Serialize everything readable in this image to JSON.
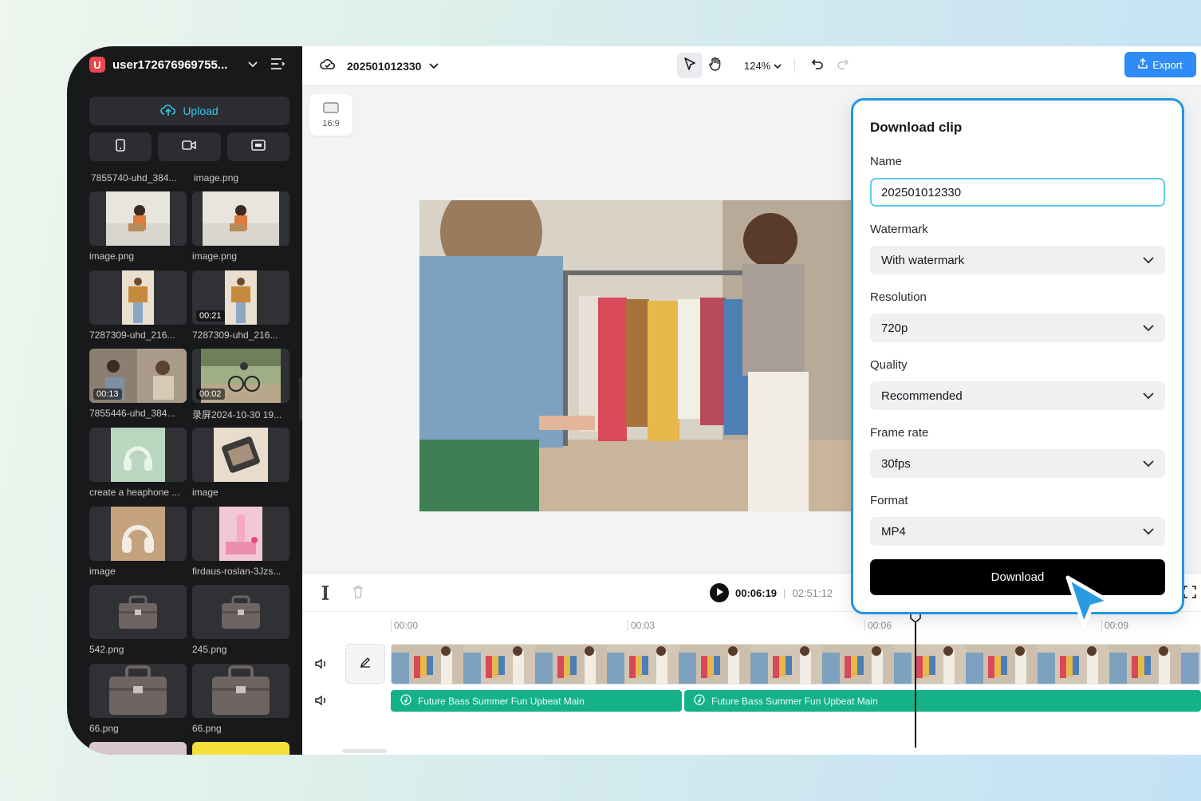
{
  "user": {
    "badge": "U",
    "name": "user172676969755..."
  },
  "sidebar": {
    "upload_label": "Upload",
    "items": [
      {
        "caption": "7855740-uhd_384...",
        "duration": ""
      },
      {
        "caption": "image.png",
        "duration": ""
      },
      {
        "caption": "image.png",
        "duration": ""
      },
      {
        "caption": "image.png",
        "duration": ""
      },
      {
        "caption": "7287309-uhd_216...",
        "duration": ""
      },
      {
        "caption": "7287309-uhd_216...",
        "duration": "00:21"
      },
      {
        "caption": "7855446-uhd_384...",
        "duration": "00:13"
      },
      {
        "caption": "录屏2024-10-30 19...",
        "duration": "00:02"
      },
      {
        "caption": "create a heaphone ...",
        "duration": ""
      },
      {
        "caption": "image",
        "duration": ""
      },
      {
        "caption": "image",
        "duration": ""
      },
      {
        "caption": "firdaus-roslan-3Jzs...",
        "duration": ""
      },
      {
        "caption": "542.png",
        "duration": ""
      },
      {
        "caption": "245.png",
        "duration": ""
      },
      {
        "caption": "66.png",
        "duration": ""
      },
      {
        "caption": "66.png",
        "duration": ""
      }
    ]
  },
  "topbar": {
    "project_title": "202501012330",
    "zoom": "124%",
    "export_label": "Export"
  },
  "canvas": {
    "ratio_label": "16:9"
  },
  "player": {
    "current_time": "00:06:19",
    "separator": "|",
    "total_time": "02:51:12"
  },
  "timeline": {
    "ticks": [
      "00:00",
      "00:03",
      "00:06",
      "00:09"
    ],
    "audio_clips": [
      "Future Bass Summer Fun Upbeat Main",
      "Future Bass Summer Fun Upbeat Main"
    ]
  },
  "dialog": {
    "title": "Download clip",
    "name_label": "Name",
    "name_value": "202501012330",
    "watermark_label": "Watermark",
    "watermark_value": "With watermark",
    "resolution_label": "Resolution",
    "resolution_value": "720p",
    "quality_label": "Quality",
    "quality_value": "Recommended",
    "framerate_label": "Frame rate",
    "framerate_value": "30fps",
    "format_label": "Format",
    "format_value": "MP4",
    "download_label": "Download"
  },
  "colors": {
    "accent": "#2f8bf5",
    "dialog_border": "#2196e3",
    "audio": "#15b28a",
    "upload_text": "#37c9e6"
  }
}
